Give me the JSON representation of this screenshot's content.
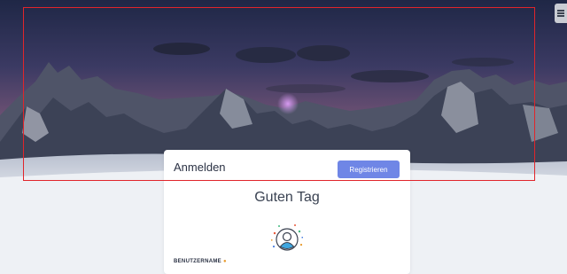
{
  "header": {
    "menu_icon": "hamburger-icon"
  },
  "login_card": {
    "title": "Anmelden",
    "register_label": "Registrieren",
    "greeting": "Guten Tag",
    "avatar_icon": "user-avatar-icon",
    "username_label": "BENUTZERNAME",
    "required_marker": "●"
  },
  "colors": {
    "accent": "#6f86e6",
    "highlight_frame": "#e0252b",
    "required": "#e89a2b",
    "page_background": "#eef1f5"
  }
}
